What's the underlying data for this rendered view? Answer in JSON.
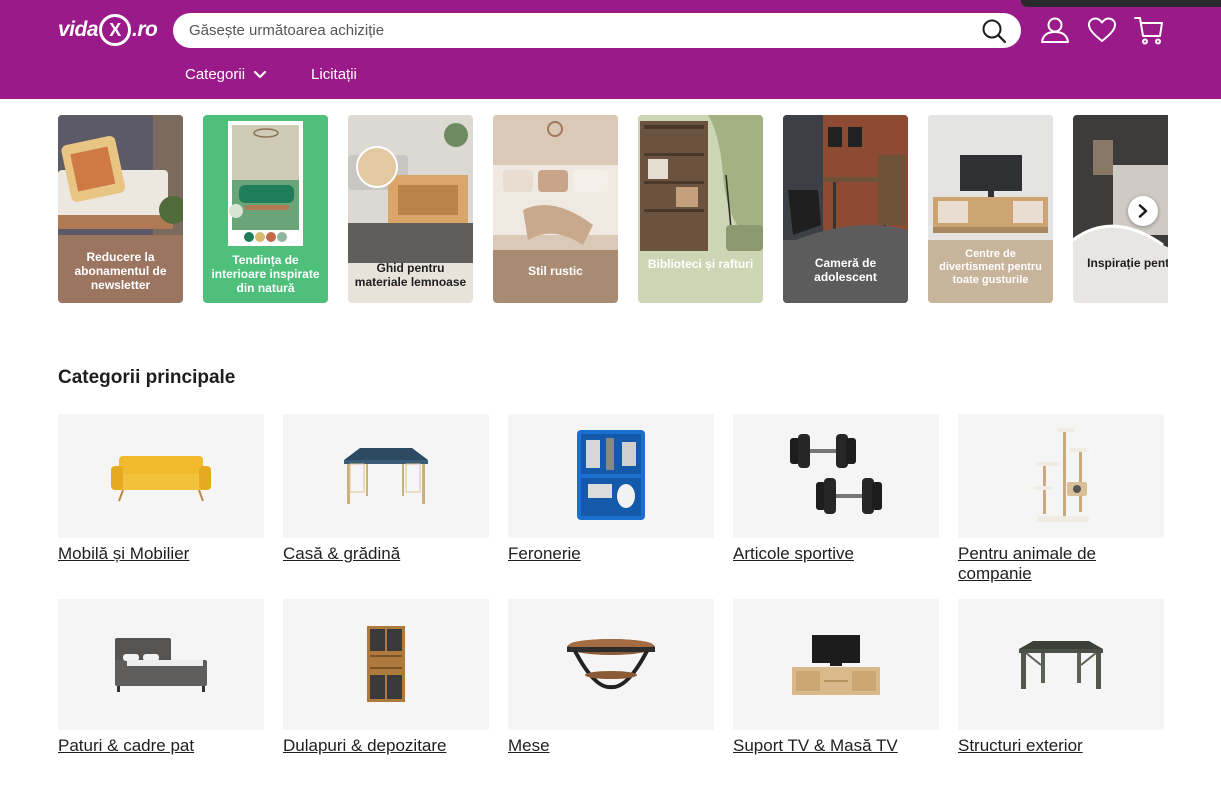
{
  "header": {
    "logo_text_left": "vida",
    "logo_x": "X",
    "logo_text_right": ".ro",
    "search_placeholder": "Găsește următoarea achiziție",
    "nav": [
      {
        "label": "Categorii"
      },
      {
        "label": "Licitații"
      }
    ]
  },
  "inspiration": [
    {
      "label": "Reducere la abonamentul de newsletter"
    },
    {
      "label": "Tendința de interioare inspirate din natură"
    },
    {
      "label": "Ghid pentru materiale lemnoase"
    },
    {
      "label": "Stil rustic"
    },
    {
      "label": "Biblioteci și rafturi"
    },
    {
      "label": "Cameră de adolescent"
    },
    {
      "label": "Centre de divertisment pentru toate gusturile"
    },
    {
      "label": "Inspirație pentru dormitor"
    }
  ],
  "categories": {
    "title": "Categorii principale",
    "items": [
      {
        "label": "Mobilă și Mobilier"
      },
      {
        "label": "Casă & grădină"
      },
      {
        "label": "Feronerie"
      },
      {
        "label": "Articole sportive"
      },
      {
        "label": "Pentru animale de companie"
      },
      {
        "label": "Paturi & cadre pat"
      },
      {
        "label": "Dulapuri & depozitare"
      },
      {
        "label": "Mese"
      },
      {
        "label": "Suport TV & Masă TV"
      },
      {
        "label": "Structuri exterior"
      }
    ]
  },
  "colors": {
    "brand": "#9b1a8a",
    "tile_bg": "#f5f5f5"
  }
}
